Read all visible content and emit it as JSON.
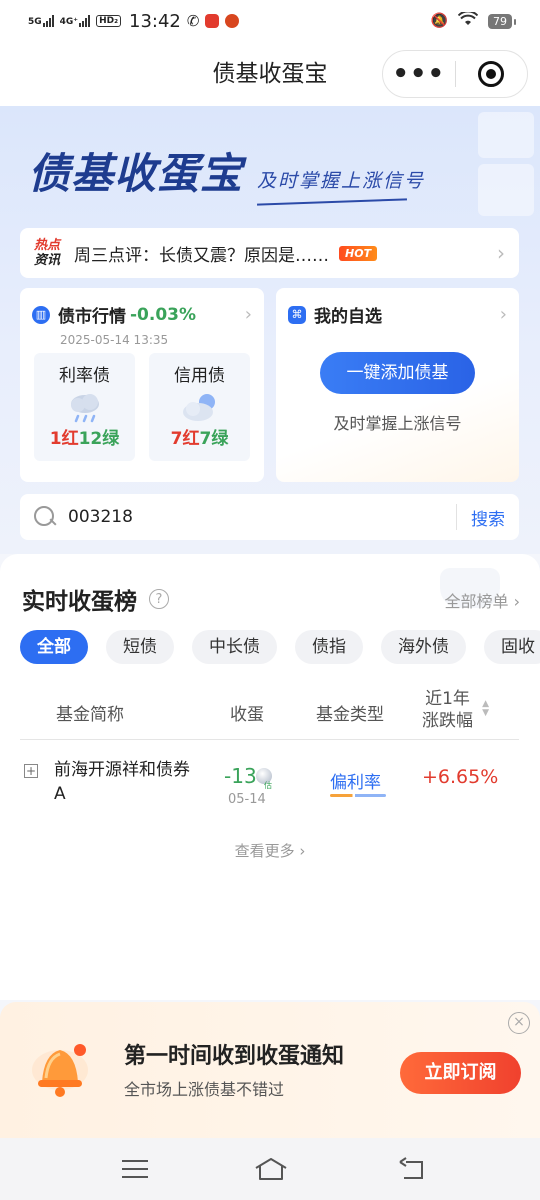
{
  "status_bar": {
    "network1": "5G",
    "network2": "4G⁺",
    "hd": "HD₂",
    "time": "13:42",
    "battery": "79"
  },
  "nav": {
    "title": "债基收蛋宝",
    "more_label": "•••"
  },
  "hero": {
    "brand": "债基收蛋宝",
    "tagline": "及时掌握上涨信号"
  },
  "news": {
    "tag_line1": "热点",
    "tag_line2": "资讯",
    "text": "周三点评：长债又震？原因是……",
    "badge": "HOT"
  },
  "market": {
    "title": "债市行情",
    "change": "-0.03%",
    "datetime": "2025-05-14 13:35",
    "rate_bond": {
      "title": "利率债",
      "red": "1红",
      "green": "12绿"
    },
    "credit_bond": {
      "title": "信用债",
      "red": "7红",
      "green": "7绿"
    }
  },
  "watchlist": {
    "title": "我的自选",
    "button": "一键添加债基",
    "subtitle": "及时掌握上涨信号"
  },
  "search": {
    "value": "003218",
    "button": "搜索"
  },
  "ranking": {
    "title": "实时收蛋榜",
    "help": "?",
    "all_link": "全部榜单",
    "tabs": [
      "全部",
      "短债",
      "中长债",
      "债指",
      "海外债",
      "固收"
    ],
    "columns": {
      "name": "基金简称",
      "eggs": "收蛋",
      "type": "基金类型",
      "year_line1": "近1年",
      "year_line2": "涨跌幅"
    },
    "rows": [
      {
        "name": "前海开源祥和债券A",
        "eggs": "-13",
        "egg_badge": "估",
        "date": "05-14",
        "type": "偏利率",
        "change": "+6.65%"
      }
    ],
    "see_more": "查看更多"
  },
  "subscribe": {
    "title": "第一时间收到收蛋通知",
    "subtitle": "全市场上涨债基不错过",
    "button": "立即订阅"
  },
  "colors": {
    "accent": "#2d6ef2",
    "up": "#e23b2e",
    "down": "#3aa35a"
  }
}
